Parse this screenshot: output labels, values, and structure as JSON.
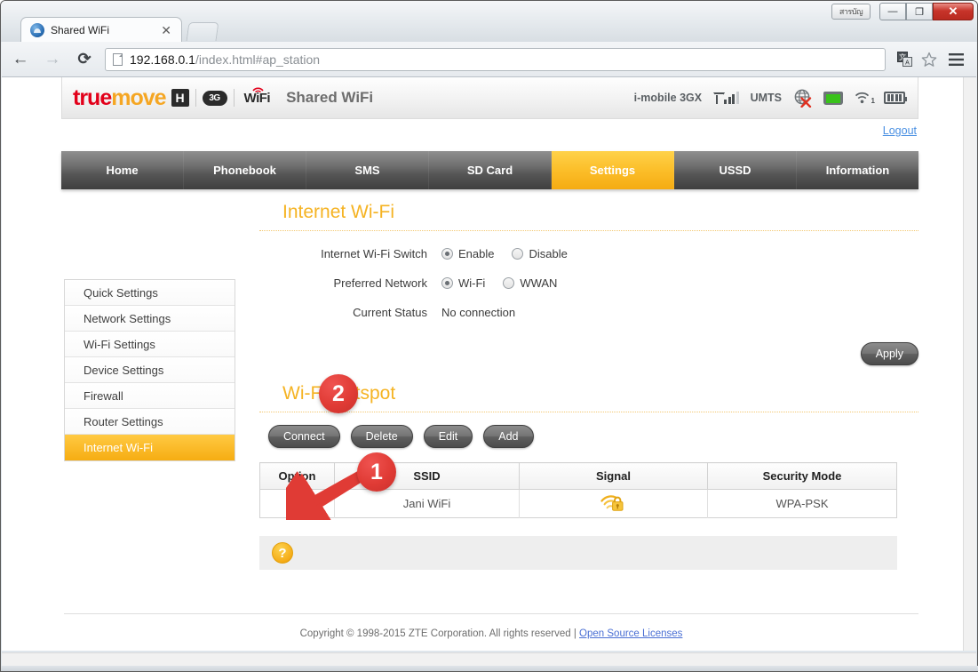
{
  "window": {
    "thai_button_label": "สารบัญ",
    "minimize_label": "—",
    "maximize_label": "❐",
    "close_label": "✕"
  },
  "browser": {
    "tab_title": "Shared WiFi",
    "tab_close_label": "✕",
    "back_label": "←",
    "forward_label": "→",
    "reload_label": "⟳",
    "url_host": "192.168.0.1",
    "url_path": "/index.html#ap_station",
    "translate_icon": "translate-icon",
    "bookmark_icon": "star-icon",
    "menu_icon": "hamburger-menu-icon"
  },
  "brand": {
    "logo_true": "true",
    "logo_move": "move",
    "logo_h": "H",
    "logo_3g": "3G",
    "logo_wifi": "WiFi",
    "title": "Shared WiFi"
  },
  "status": {
    "operator": "i-mobile 3GX",
    "network_type": "UMTS",
    "signal_bars_on": 3,
    "signal_bars_total": 4,
    "wifi_clients": "1"
  },
  "account": {
    "logout_label": "Logout"
  },
  "nav": {
    "items": [
      {
        "label": "Home",
        "active": false
      },
      {
        "label": "Phonebook",
        "active": false
      },
      {
        "label": "SMS",
        "active": false
      },
      {
        "label": "SD Card",
        "active": false
      },
      {
        "label": "Settings",
        "active": true
      },
      {
        "label": "USSD",
        "active": false
      },
      {
        "label": "Information",
        "active": false
      }
    ]
  },
  "sidebar": {
    "items": [
      {
        "label": "Quick Settings",
        "active": false
      },
      {
        "label": "Network Settings",
        "active": false
      },
      {
        "label": "Wi-Fi Settings",
        "active": false
      },
      {
        "label": "Device Settings",
        "active": false
      },
      {
        "label": "Firewall",
        "active": false
      },
      {
        "label": "Router Settings",
        "active": false
      },
      {
        "label": "Internet Wi-Fi",
        "active": true
      }
    ]
  },
  "internet_wifi": {
    "section_title": "Internet Wi-Fi",
    "switch_label": "Internet Wi-Fi Switch",
    "switch_enable": "Enable",
    "switch_disable": "Disable",
    "switch_value": "Enable",
    "preferred_label": "Preferred Network",
    "preferred_wifi": "Wi-Fi",
    "preferred_wwan": "WWAN",
    "preferred_value": "Wi-Fi",
    "status_label": "Current Status",
    "status_value": "No connection",
    "apply_label": "Apply"
  },
  "hotspot": {
    "section_title": "Wi-Fi Hotspot",
    "buttons": [
      {
        "label": "Connect"
      },
      {
        "label": "Delete"
      },
      {
        "label": "Edit"
      },
      {
        "label": "Add"
      }
    ],
    "columns": [
      "Option",
      "SSID",
      "Signal",
      "Security Mode"
    ],
    "rows": [
      {
        "option_selected": true,
        "ssid": "Jani WiFi",
        "signal": "wifi-locked-icon",
        "security": "WPA-PSK"
      }
    ]
  },
  "help": {
    "icon_label": "?"
  },
  "footer": {
    "copyright": "Copyright © 1998-2015 ZTE Corporation. All rights reserved  |  ",
    "link": "Open Source Licenses"
  },
  "annotations": [
    {
      "number": "1",
      "target": "option-radio-button"
    },
    {
      "number": "2",
      "target": "connect-button"
    }
  ],
  "colors": {
    "accent_orange": "#f5b323",
    "brand_red": "#e2001a",
    "marker_red": "#e03b35",
    "link_blue": "#4a90e2"
  }
}
